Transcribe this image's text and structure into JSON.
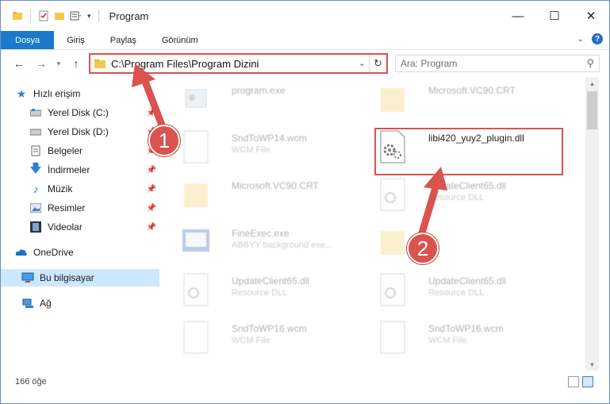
{
  "window": {
    "title": "Program"
  },
  "ribbon": {
    "tabs": [
      "Dosya",
      "Giriş",
      "Paylaş",
      "Görünüm"
    ]
  },
  "address": {
    "path": "C:\\Program Files\\Program Dizini"
  },
  "search": {
    "placeholder": "Ara: Program"
  },
  "sidebar": {
    "items": [
      {
        "label": "Hızlı erişim",
        "icon": "star-icon"
      },
      {
        "label": "Yerel Disk (C:)",
        "icon": "drive-icon"
      },
      {
        "label": "Yerel Disk (D:)",
        "icon": "drive-icon"
      },
      {
        "label": "Belgeler",
        "icon": "documents-icon"
      },
      {
        "label": "İndirmeler",
        "icon": "download-icon"
      },
      {
        "label": "Müzik",
        "icon": "music-icon"
      },
      {
        "label": "Resimler",
        "icon": "pictures-icon"
      },
      {
        "label": "Videolar",
        "icon": "videos-icon"
      },
      {
        "label": "OneDrive",
        "icon": "cloud-icon"
      },
      {
        "label": "Bu bilgisayar",
        "icon": "computer-icon"
      },
      {
        "label": "Ağ",
        "icon": "network-icon"
      }
    ]
  },
  "files": [
    {
      "name": "program.exe",
      "sub": "",
      "type": "exe",
      "faded": true
    },
    {
      "name": "Microsoft.VC90.CRT",
      "sub": "",
      "type": "folder",
      "faded": true
    },
    {
      "name": "SndToWP14.wcm",
      "sub": "WCM File",
      "type": "file",
      "faded": true
    },
    {
      "name": "libi420_yuy2_plugin.dll",
      "sub": "",
      "type": "dll",
      "faded": false
    },
    {
      "name": "Microsoft.VC90.CRT",
      "sub": "",
      "type": "folder",
      "faded": true
    },
    {
      "name": "UpdateClient65.dll",
      "sub": "Resource DLL",
      "type": "dll",
      "faded": true
    },
    {
      "name": "FineExec.exe",
      "sub": "ABBYY background exe...",
      "type": "exe",
      "faded": true
    },
    {
      "name": "",
      "sub": "",
      "type": "folder",
      "faded": true
    },
    {
      "name": "UpdateClient65.dll",
      "sub": "Resource DLL",
      "type": "dll",
      "faded": true
    },
    {
      "name": "UpdateClient65.dll",
      "sub": "Resource DLL",
      "type": "dll",
      "faded": true
    },
    {
      "name": "SndToWP16.wcm",
      "sub": "WCM File",
      "type": "file",
      "faded": true
    },
    {
      "name": "SndToWP16.wcm",
      "sub": "WCM File",
      "type": "file",
      "faded": true
    }
  ],
  "status": {
    "count": "166 öğe"
  },
  "annotations": {
    "step1": "1",
    "step2": "2",
    "color": "#d9534f"
  }
}
